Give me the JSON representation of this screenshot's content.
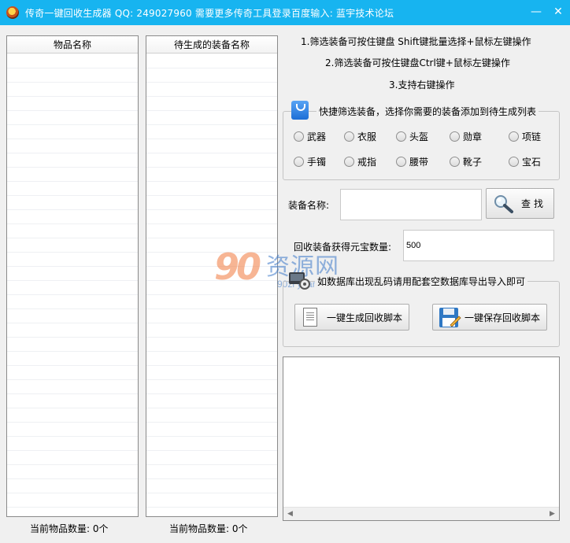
{
  "window": {
    "title": "传奇一键回收生成器   QQ: 249027960   需要更多传奇工具登录百度输入: 蓝宇技术论坛",
    "minimize_glyph": "—",
    "close_glyph": "✕"
  },
  "lists": {
    "left_header": "物品名称",
    "right_header": "待生成的装备名称",
    "left_count": "当前物品数量: 0个",
    "right_count": "当前物品数量: 0个"
  },
  "tips": [
    "1.筛选装备可按住键盘 Shift键批量选择+鼠标左键操作",
    "2.筛选装备可按住键盘Ctrl键+鼠标左键操作",
    "3.支持右键操作"
  ],
  "filter": {
    "caption": "快捷筛选装备，选择你需要的装备添加到待生成列表",
    "options": [
      "武器",
      "衣服",
      "头盔",
      "勋章",
      "项链",
      "手镯",
      "戒指",
      "腰带",
      "靴子",
      "宝石"
    ]
  },
  "search": {
    "label": "装备名称:",
    "value": "",
    "button": "查找"
  },
  "yuanbao": {
    "label": "回收装备获得元宝数量:",
    "value": "500"
  },
  "script": {
    "caption": "如数据库出现乱码请用配套空数据库导出导入即可",
    "generate_button": "一键生成回收脚本",
    "save_button": "一键保存回收脚本"
  },
  "output": {
    "text": "",
    "scroll_left": "◀",
    "scroll_right": "▶"
  },
  "watermark": {
    "logo": "90",
    "name": "资源网",
    "url": "90zi yuan.com"
  },
  "icons": {
    "app": "app-icon",
    "bag": "bag-icon",
    "search": "magnifier-icon",
    "document": "document-icon",
    "save": "floppy-disk-icon",
    "gear": "gear-icon"
  }
}
